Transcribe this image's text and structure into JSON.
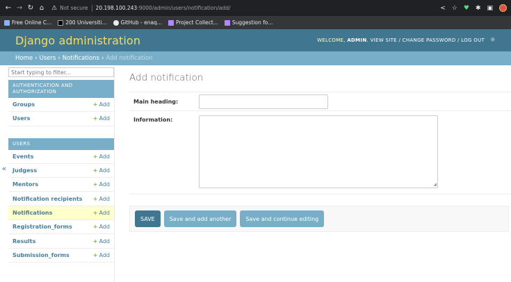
{
  "browser": {
    "not_secure": "Not secure",
    "url_host": "20.198.100.243",
    "url_path": ":9000/admin/users/notification/add/",
    "bookmarks": [
      "Free Online C...",
      "200 Universiti...",
      "GitHub - enaq...",
      "Project Collect...",
      "Suggestion fo..."
    ]
  },
  "header": {
    "branding": "Django administration",
    "welcome": "WELCOME,",
    "user": "ADMIN",
    "view_site": "VIEW SITE",
    "change_password": "CHANGE PASSWORD",
    "log_out": "LOG OUT",
    "slash": "/"
  },
  "breadcrumbs": {
    "home": "Home",
    "users": "Users",
    "notifications": "Notifications",
    "current": "Add notification",
    "sep": "›"
  },
  "sidebar": {
    "filter_placeholder": "Start typing to filter...",
    "collapse": "«",
    "add_label": "Add",
    "modules": [
      {
        "caption": "AUTHENTICATION AND AUTHORIZATION",
        "models": [
          "Groups",
          "Users"
        ]
      },
      {
        "caption": "USERS",
        "models": [
          "Events",
          "Judgess",
          "Mentors",
          "Notification recipients",
          "Notifications",
          "Registration_forms",
          "Results",
          "Submission_forms"
        ]
      }
    ]
  },
  "form": {
    "title": "Add notification",
    "main_heading_label": "Main heading:",
    "main_heading_value": "",
    "information_label": "Information:",
    "information_value": "",
    "save": "SAVE",
    "save_add_another": "Save and add another",
    "save_continue": "Save and continue editing"
  }
}
